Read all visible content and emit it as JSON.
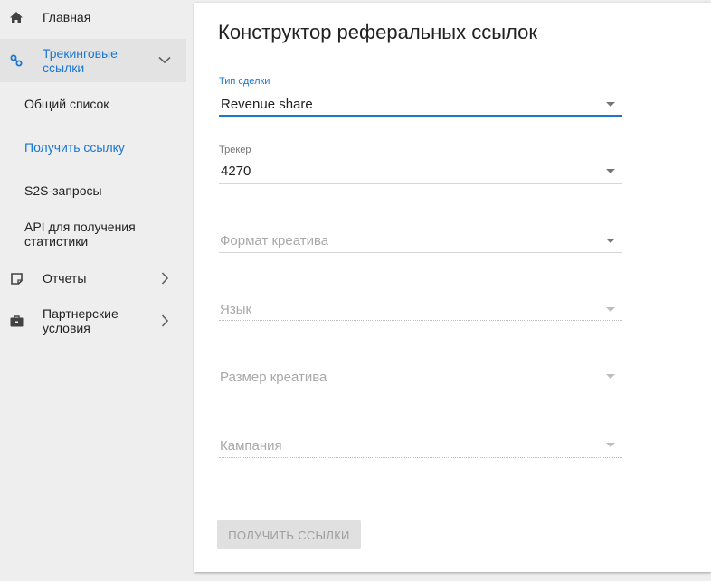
{
  "sidebar": {
    "items": [
      {
        "label": "Главная",
        "icon": "home-icon"
      },
      {
        "label": "Трекинговые ссылки",
        "icon": "link-icon",
        "expanded": true,
        "sub_items": [
          {
            "label": "Общий список"
          },
          {
            "label": "Получить ссылку",
            "current": true
          },
          {
            "label": "S2S-запросы"
          },
          {
            "label": "API для получения статистики"
          }
        ]
      },
      {
        "label": "Отчеты",
        "icon": "note-icon"
      },
      {
        "label": "Партнерские условия",
        "icon": "briefcase-icon"
      }
    ]
  },
  "main": {
    "title": "Конструктор реферальных ссылок",
    "fields": [
      {
        "label": "Тип сделки",
        "value": "Revenue share",
        "focused": true
      },
      {
        "label": "Трекер",
        "value": "4270"
      },
      {
        "placeholder": "Формат креатива"
      },
      {
        "placeholder": "Язык",
        "disabled": true
      },
      {
        "placeholder": "Размер креатива",
        "disabled": true
      },
      {
        "placeholder": "Кампания",
        "disabled": true
      }
    ],
    "submit_label": "Получить ссылки"
  },
  "colors": {
    "accent": "#1976d2",
    "sidebar_bg": "#eeeeee",
    "active_item_bg": "#e3e3e3",
    "card_bg": "#ffffff",
    "button_disabled_bg": "#e0e0e0"
  }
}
